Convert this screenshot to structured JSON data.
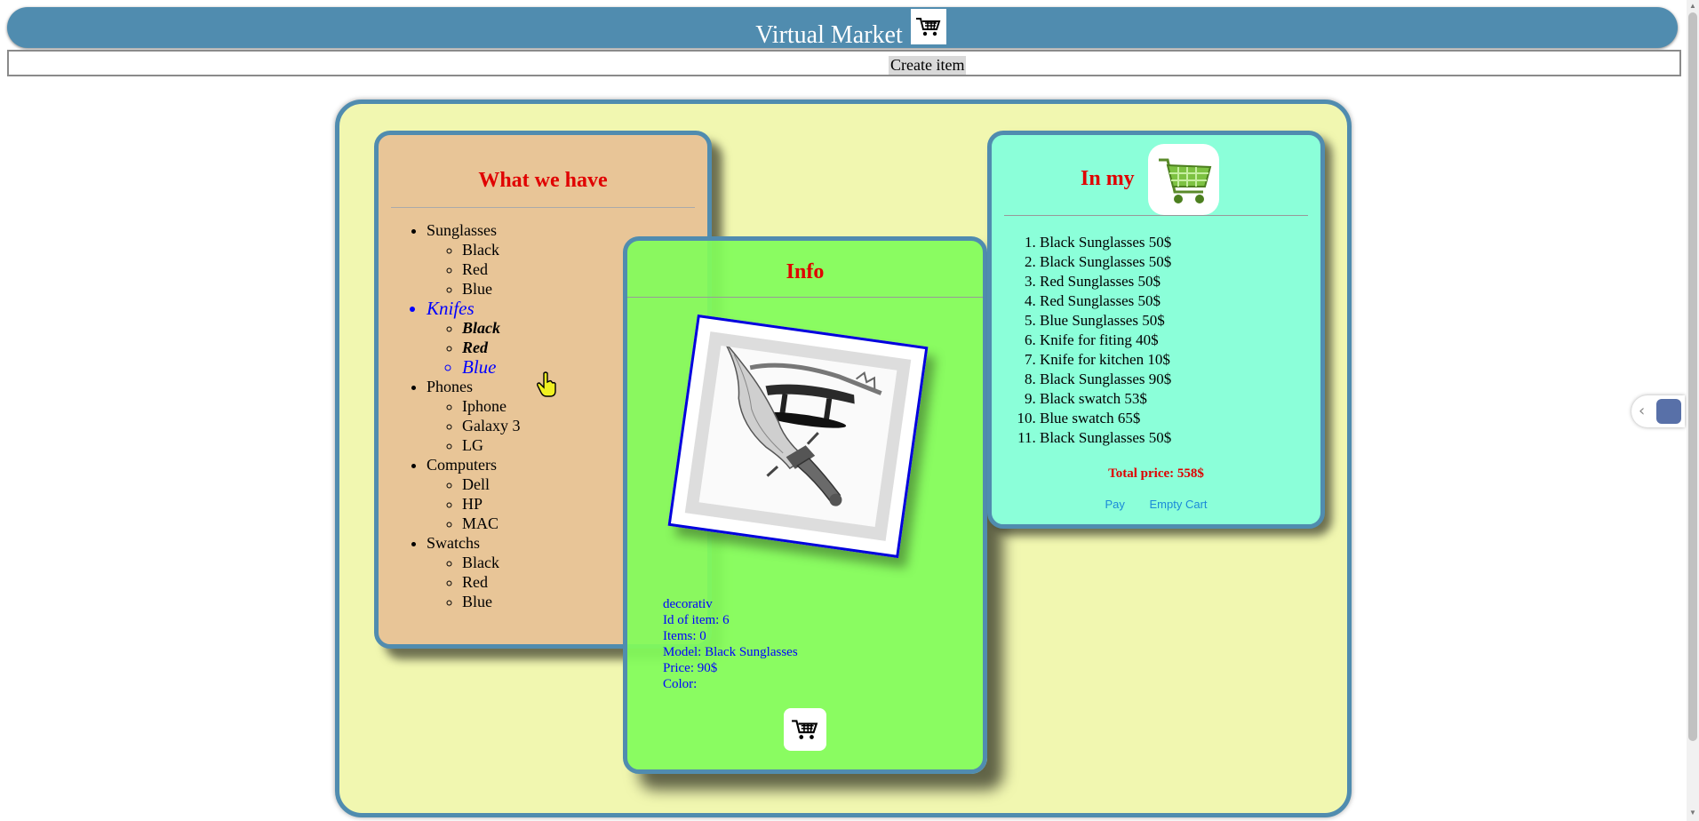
{
  "header": {
    "title": "Virtual Market",
    "cart_icon": "cart-icon"
  },
  "toolbar": {
    "create_label": "Create item"
  },
  "catalog": {
    "title": "What we have",
    "categories": [
      {
        "label": "Sunglasses",
        "items": [
          "Black",
          "Red",
          "Blue"
        ]
      },
      {
        "label": "Knifes",
        "items": [
          "Black",
          "Red",
          "Blue"
        ]
      },
      {
        "label": "Phones",
        "items": [
          "Iphone",
          "Galaxy 3",
          "LG"
        ]
      },
      {
        "label": "Computers",
        "items": [
          "Dell",
          "HP",
          "MAC"
        ]
      },
      {
        "label": "Swatchs",
        "items": [
          "Black",
          "Red",
          "Blue"
        ]
      }
    ]
  },
  "info": {
    "title": "Info",
    "description": "decorativ",
    "id_line": "Id of item: 6",
    "items_line": "Items: 0",
    "model_line": "Model: Black Sunglasses",
    "price_line": "Price: 90$",
    "color_line": "Color:"
  },
  "cart": {
    "title": "In my",
    "items": [
      "Black Sunglasses 50$",
      "Black Sunglasses 50$",
      "Red Sunglasses 50$",
      "Red Sunglasses 50$",
      "Blue Sunglasses 50$",
      "Knife for fiting 40$",
      "Knife for kitchen 10$",
      "Black Sunglasses 90$",
      "Black swatch 53$",
      "Blue swatch 65$",
      "Black Sunglasses 50$"
    ],
    "total": "Total price: 558$",
    "pay_label": "Pay",
    "empty_label": "Empty Cart"
  },
  "colors": {
    "header": "#508caf",
    "accent_red": "#e00000",
    "link_blue": "#0000ff"
  }
}
